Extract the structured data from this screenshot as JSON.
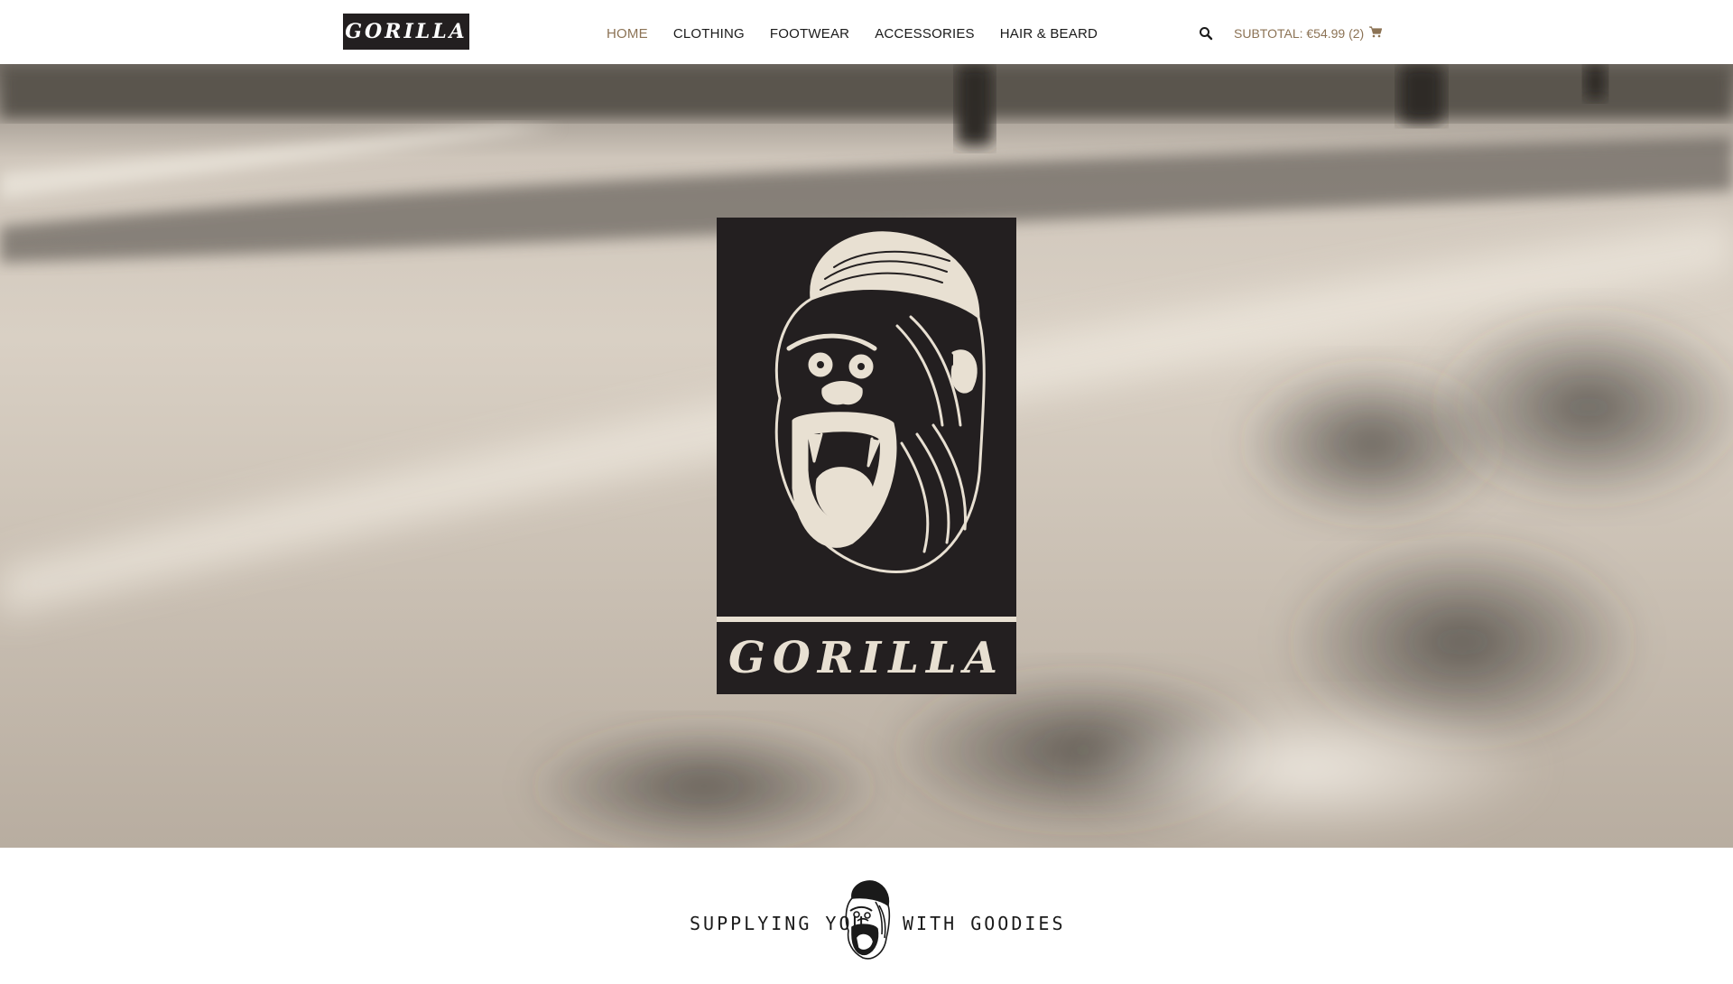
{
  "header": {
    "logo_text": "GORILLA",
    "nav": [
      {
        "label": "HOME",
        "active": true
      },
      {
        "label": "CLOTHING",
        "active": false
      },
      {
        "label": "FOOTWEAR",
        "active": false
      },
      {
        "label": "ACCESSORIES",
        "active": false
      },
      {
        "label": "HAIR & BEARD",
        "active": false
      }
    ],
    "search_icon": "search-icon",
    "cart": {
      "text": "SUBTOTAL: €54.99 (2)",
      "icon": "cart-icon"
    }
  },
  "hero": {
    "background": "blurred road with motorcycles (sepia photo)",
    "logo_wordmark": "GORILLA",
    "emblem_icon": "gorilla-head-icon"
  },
  "tagline": {
    "left": "SUPPLYING YOU",
    "right": "WITH GOODIES",
    "icon": "gorilla-head-icon"
  },
  "colors": {
    "accent": "#8c7355",
    "dark": "#231f20",
    "cream": "#e8e0d2",
    "text": "#1a1a1a"
  }
}
